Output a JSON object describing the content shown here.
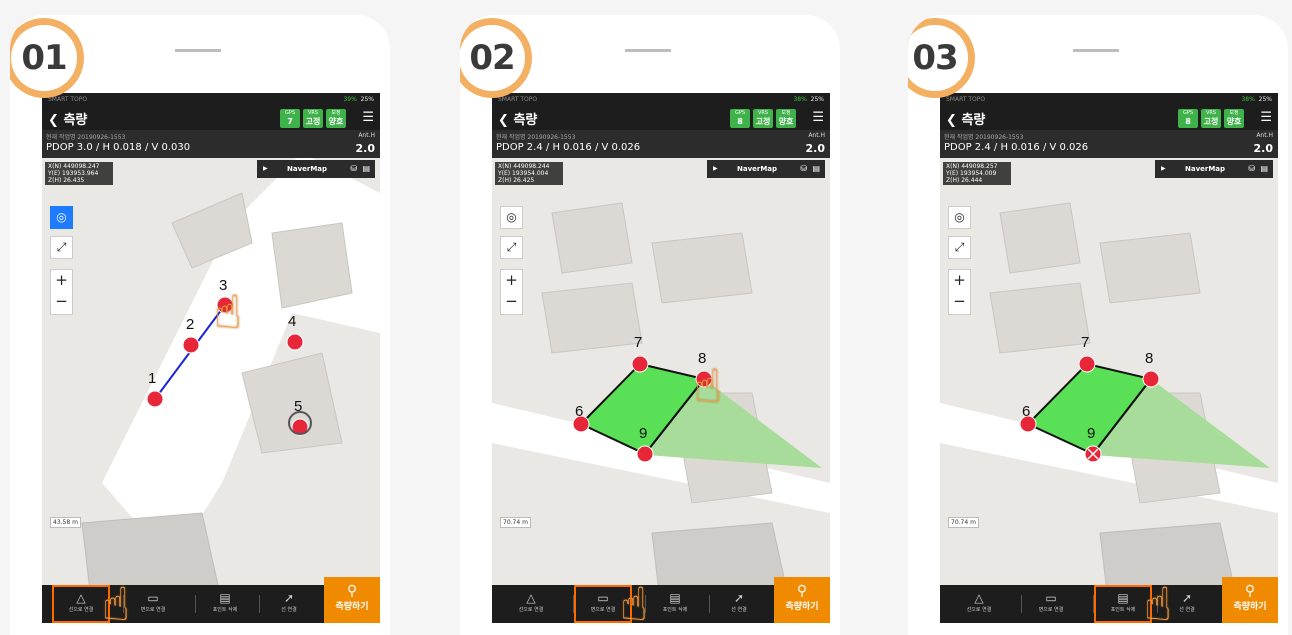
{
  "steps": [
    {
      "number": "01",
      "status": {
        "app": "SMART TOPO",
        "gps_battery": "39%",
        "phone_battery": "25%"
      },
      "header": {
        "title": "측량",
        "gps_label": "GPS",
        "gps_value": "7",
        "vrs_label": "VRS",
        "vrs_value": "고정",
        "signal_label": "보정",
        "signal_value": "양호"
      },
      "info": {
        "job": "현재 작업명 20190926-1553",
        "pdop": "PDOP 3.0 / H 0.018 / V 0.030",
        "ant_label": "Ant.H",
        "ant_value": "2.0"
      },
      "coords": {
        "n": "X(N) 449098.247",
        "e": "Y(E) 193953.964",
        "h": "Z(H) 26.435"
      },
      "map_source": "NaverMap",
      "point_labels": [
        "1",
        "2",
        "3",
        "4",
        "5"
      ],
      "scale": "43.58 m",
      "tools": [
        "선으로 연결",
        "면으로 연결",
        "포인트 삭제",
        "선 연결"
      ],
      "measure_label": "측량하기"
    },
    {
      "number": "02",
      "status": {
        "app": "SMART TOPO",
        "gps_battery": "38%",
        "phone_battery": "25%"
      },
      "header": {
        "title": "측량",
        "gps_label": "GPS",
        "gps_value": "8",
        "vrs_label": "VRS",
        "vrs_value": "고정",
        "signal_label": "보정",
        "signal_value": "양호"
      },
      "info": {
        "job": "현재 작업명 20190926-1553",
        "pdop": "PDOP 2.4 / H 0.016 / V 0.026",
        "ant_label": "Ant.H",
        "ant_value": "2.0"
      },
      "coords": {
        "n": "X(N) 449098.244",
        "e": "Y(E) 193954.004",
        "h": "Z(H) 26.425"
      },
      "map_source": "NaverMap",
      "point_labels": [
        "6",
        "7",
        "8",
        "9"
      ],
      "scale": "70.74 m",
      "tools": [
        "선으로 연결",
        "면으로 연결",
        "포인트 삭제",
        "선 연결"
      ],
      "measure_label": "측량하기"
    },
    {
      "number": "03",
      "status": {
        "app": "SMART TOPO",
        "gps_battery": "38%",
        "phone_battery": "25%"
      },
      "header": {
        "title": "측량",
        "gps_label": "GPS",
        "gps_value": "8",
        "vrs_label": "VRS",
        "vrs_value": "고정",
        "signal_label": "보정",
        "signal_value": "양호"
      },
      "info": {
        "job": "현재 작업명 20190926-1553",
        "pdop": "PDOP 2.4 / H 0.016 / V 0.026",
        "ant_label": "Ant.H",
        "ant_value": "2.0"
      },
      "coords": {
        "n": "X(N) 449098.257",
        "e": "Y(E) 193954.009",
        "h": "Z(H) 26.444"
      },
      "map_source": "NaverMap",
      "point_labels": [
        "6",
        "7",
        "8",
        "9"
      ],
      "scale": "70.74 m",
      "tools": [
        "선으로 연결",
        "면으로 연결",
        "포인트 삭제",
        "선 연결"
      ],
      "measure_label": "측량하기"
    }
  ],
  "colors": {
    "accent": "#f3b063",
    "measure": "#f08a00",
    "point": "#e8263a",
    "polygon_fill": "#59e056",
    "line": "#1a23d6",
    "selected": "#ff6a00"
  },
  "icons": {
    "back": "chevron-left-icon",
    "menu": "hamburger-icon",
    "hand": "pointing-hand-icon"
  }
}
